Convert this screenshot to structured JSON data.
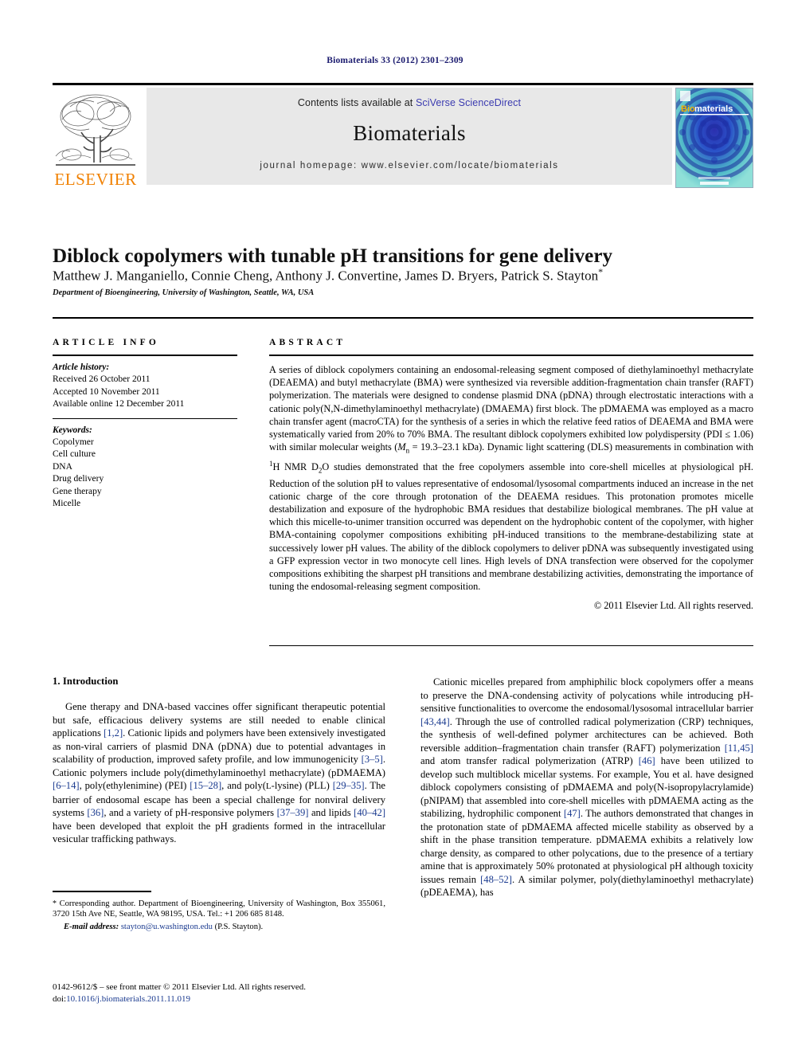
{
  "running_head": "Biomaterials 33 (2012) 2301–2309",
  "masthead": {
    "contents_prefix": "Contents lists available at ",
    "contents_link": "SciVerse ScienceDirect",
    "journal_name": "Biomaterials",
    "homepage": "journal homepage: www.elsevier.com/locate/biomaterials",
    "publisher_logo_text": "ELSEVIER",
    "cover_title_bio": "Bio",
    "cover_title_materials": "materials"
  },
  "article": {
    "title": "Diblock copolymers with tunable pH transitions for gene delivery",
    "authors": "Matthew J. Manganiello, Connie Cheng, Anthony J. Convertine, James D. Bryers, Patrick S. Stayton",
    "corresponding_marker": "*",
    "affiliation": "Department of Bioengineering, University of Washington, Seattle, WA, USA"
  },
  "article_info": {
    "heading": "ARTICLE INFO",
    "history_label": "Article history:",
    "history": [
      "Received 26 October 2011",
      "Accepted 10 November 2011",
      "Available online 12 December 2011"
    ],
    "keywords_label": "Keywords:",
    "keywords": [
      "Copolymer",
      "Cell culture",
      "DNA",
      "Drug delivery",
      "Gene therapy",
      "Micelle"
    ]
  },
  "abstract": {
    "heading": "ABSTRACT",
    "p1": "A series of diblock copolymers containing an endosomal-releasing segment composed of diethylaminoethyl methacrylate (DEAEMA) and butyl methacrylate (BMA) were synthesized via reversible addition-fragmentation chain transfer (RAFT) polymerization. The materials were designed to condense plasmid DNA (pDNA) through electrostatic interactions with a cationic poly(N,N-dimethylaminoethyl methacrylate) (DMAEMA) first block. The pDMAEMA was employed as a macro chain transfer agent (macroCTA) for the synthesis of a series in which the relative feed ratios of DEAEMA and BMA were systematically varied from 20% to 70% BMA. The resultant diblock copolymers exhibited low polydispersity (PDI ≤ 1.06) with similar molecular weights (",
    "mn_italic": "M",
    "mn_sub": "n",
    "p2": " = 19.3–23.1 kDa). Dynamic light scattering (DLS) measurements in combination with ",
    "nmr_sup": "1",
    "p3": "H NMR D",
    "d2o_sub": "2",
    "p4": "O studies demonstrated that the free copolymers assemble into core-shell micelles at physiological pH. Reduction of the solution pH to values representative of endosomal/lysosomal compartments induced an increase in the net cationic charge of the core through protonation of the DEAEMA residues. This protonation promotes micelle destabilization and exposure of the hydrophobic BMA residues that destabilize biological membranes. The pH value at which this micelle-to-unimer transition occurred was dependent on the hydrophobic content of the copolymer, with higher BMA-containing copolymer compositions exhibiting pH-induced transitions to the membrane-destabilizing state at successively lower pH values. The ability of the diblock copolymers to deliver pDNA was subsequently investigated using a GFP expression vector in two monocyte cell lines. High levels of DNA transfection were observed for the copolymer compositions exhibiting the sharpest pH transitions and membrane destabilizing activities, demonstrating the importance of tuning the endosomal-releasing segment composition.",
    "copyright": "© 2011 Elsevier Ltd. All rights reserved."
  },
  "introduction": {
    "heading": "1. Introduction",
    "left_p1_a": "Gene therapy and DNA-based vaccines offer significant therapeutic potential but safe, efficacious delivery systems are still needed to enable clinical applications ",
    "left_ref1": "[1,2]",
    "left_p1_b": ". Cationic lipids and polymers have been extensively investigated as non-viral carriers of plasmid DNA (pDNA) due to potential advantages in scalability of production, improved safety profile, and low immunogenicity ",
    "left_ref2": "[3–5]",
    "left_p1_c": ". Cationic polymers include poly(dimethylaminoethyl methacrylate) (pDMAEMA) ",
    "left_ref3": "[6–14]",
    "left_p1_d": ", poly(ethylenimine) (PEI) ",
    "left_ref4": "[15–28]",
    "left_p1_e": ", and poly(",
    "left_lysine_sc": "L",
    "left_p1_f": "-lysine) (PLL) ",
    "left_ref5": "[29–35]",
    "left_p1_g": ". The barrier of endosomal escape has been a special challenge for nonviral delivery systems ",
    "left_ref6": "[36]",
    "left_p1_h": ", and a variety of pH-responsive polymers ",
    "left_ref7": "[37–39]",
    "left_p1_i": " and lipids ",
    "left_ref8": "[40–42]",
    "left_p1_j": " have been developed that exploit the pH gradients formed in the intracellular vesicular trafficking pathways.",
    "right_p1_a": "Cationic micelles prepared from amphiphilic block copolymers offer a means to preserve the DNA-condensing activity of polycations while introducing pH-sensitive functionalities to overcome the endosomal/lysosomal intracellular barrier ",
    "right_ref1": "[43,44]",
    "right_p1_b": ". Through the use of controlled radical polymerization (CRP) techniques, the synthesis of well-defined polymer architectures can be achieved. Both reversible addition–fragmentation chain transfer (RAFT) polymerization ",
    "right_ref2": "[11,45]",
    "right_p1_c": " and atom transfer radical polymerization (ATRP) ",
    "right_ref3": "[46]",
    "right_p1_d": " have been utilized to develop such multiblock micellar systems. For example, You et al. have designed diblock copolymers consisting of pDMAEMA and poly(N-isopropylacrylamide) (pNIPAM) that assembled into core-shell micelles with pDMAEMA acting as the stabilizing, hydrophilic component ",
    "right_ref4": "[47]",
    "right_p1_e": ". The authors demonstrated that changes in the protonation state of pDMAEMA affected micelle stability as observed by a shift in the phase transition temperature. pDMAEMA exhibits a relatively low charge density, as compared to other polycations, due to the presence of a tertiary amine that is approximately 50% protonated at physiological pH although toxicity issues remain ",
    "right_ref5": "[48–52]",
    "right_p1_f": ". A similar polymer, poly(diethylaminoethyl methacrylate) (pDEAEMA), has"
  },
  "footnote": {
    "star": "*",
    "text": " Corresponding author. Department of Bioengineering, University of Washington, Box 355061, 3720 15th Ave NE, Seattle, WA 98195, USA. Tel.: +1 206 685 8148.",
    "email_label": "E-mail address:",
    "email": "stayton@u.washington.edu",
    "email_owner": "(P.S. Stayton)."
  },
  "frontmatter": {
    "issn_line": "0142-9612/$ – see front matter © 2011 Elsevier Ltd. All rights reserved.",
    "doi_label": "doi:",
    "doi": "10.1016/j.biomaterials.2011.11.019"
  },
  "colors": {
    "link_blue": "#3b3bb0",
    "ref_blue": "#1a3a8f",
    "runhead_navy": "#1a1a6e",
    "elsevier_orange": "#f08000",
    "band_gray": "#e8e8e8"
  }
}
